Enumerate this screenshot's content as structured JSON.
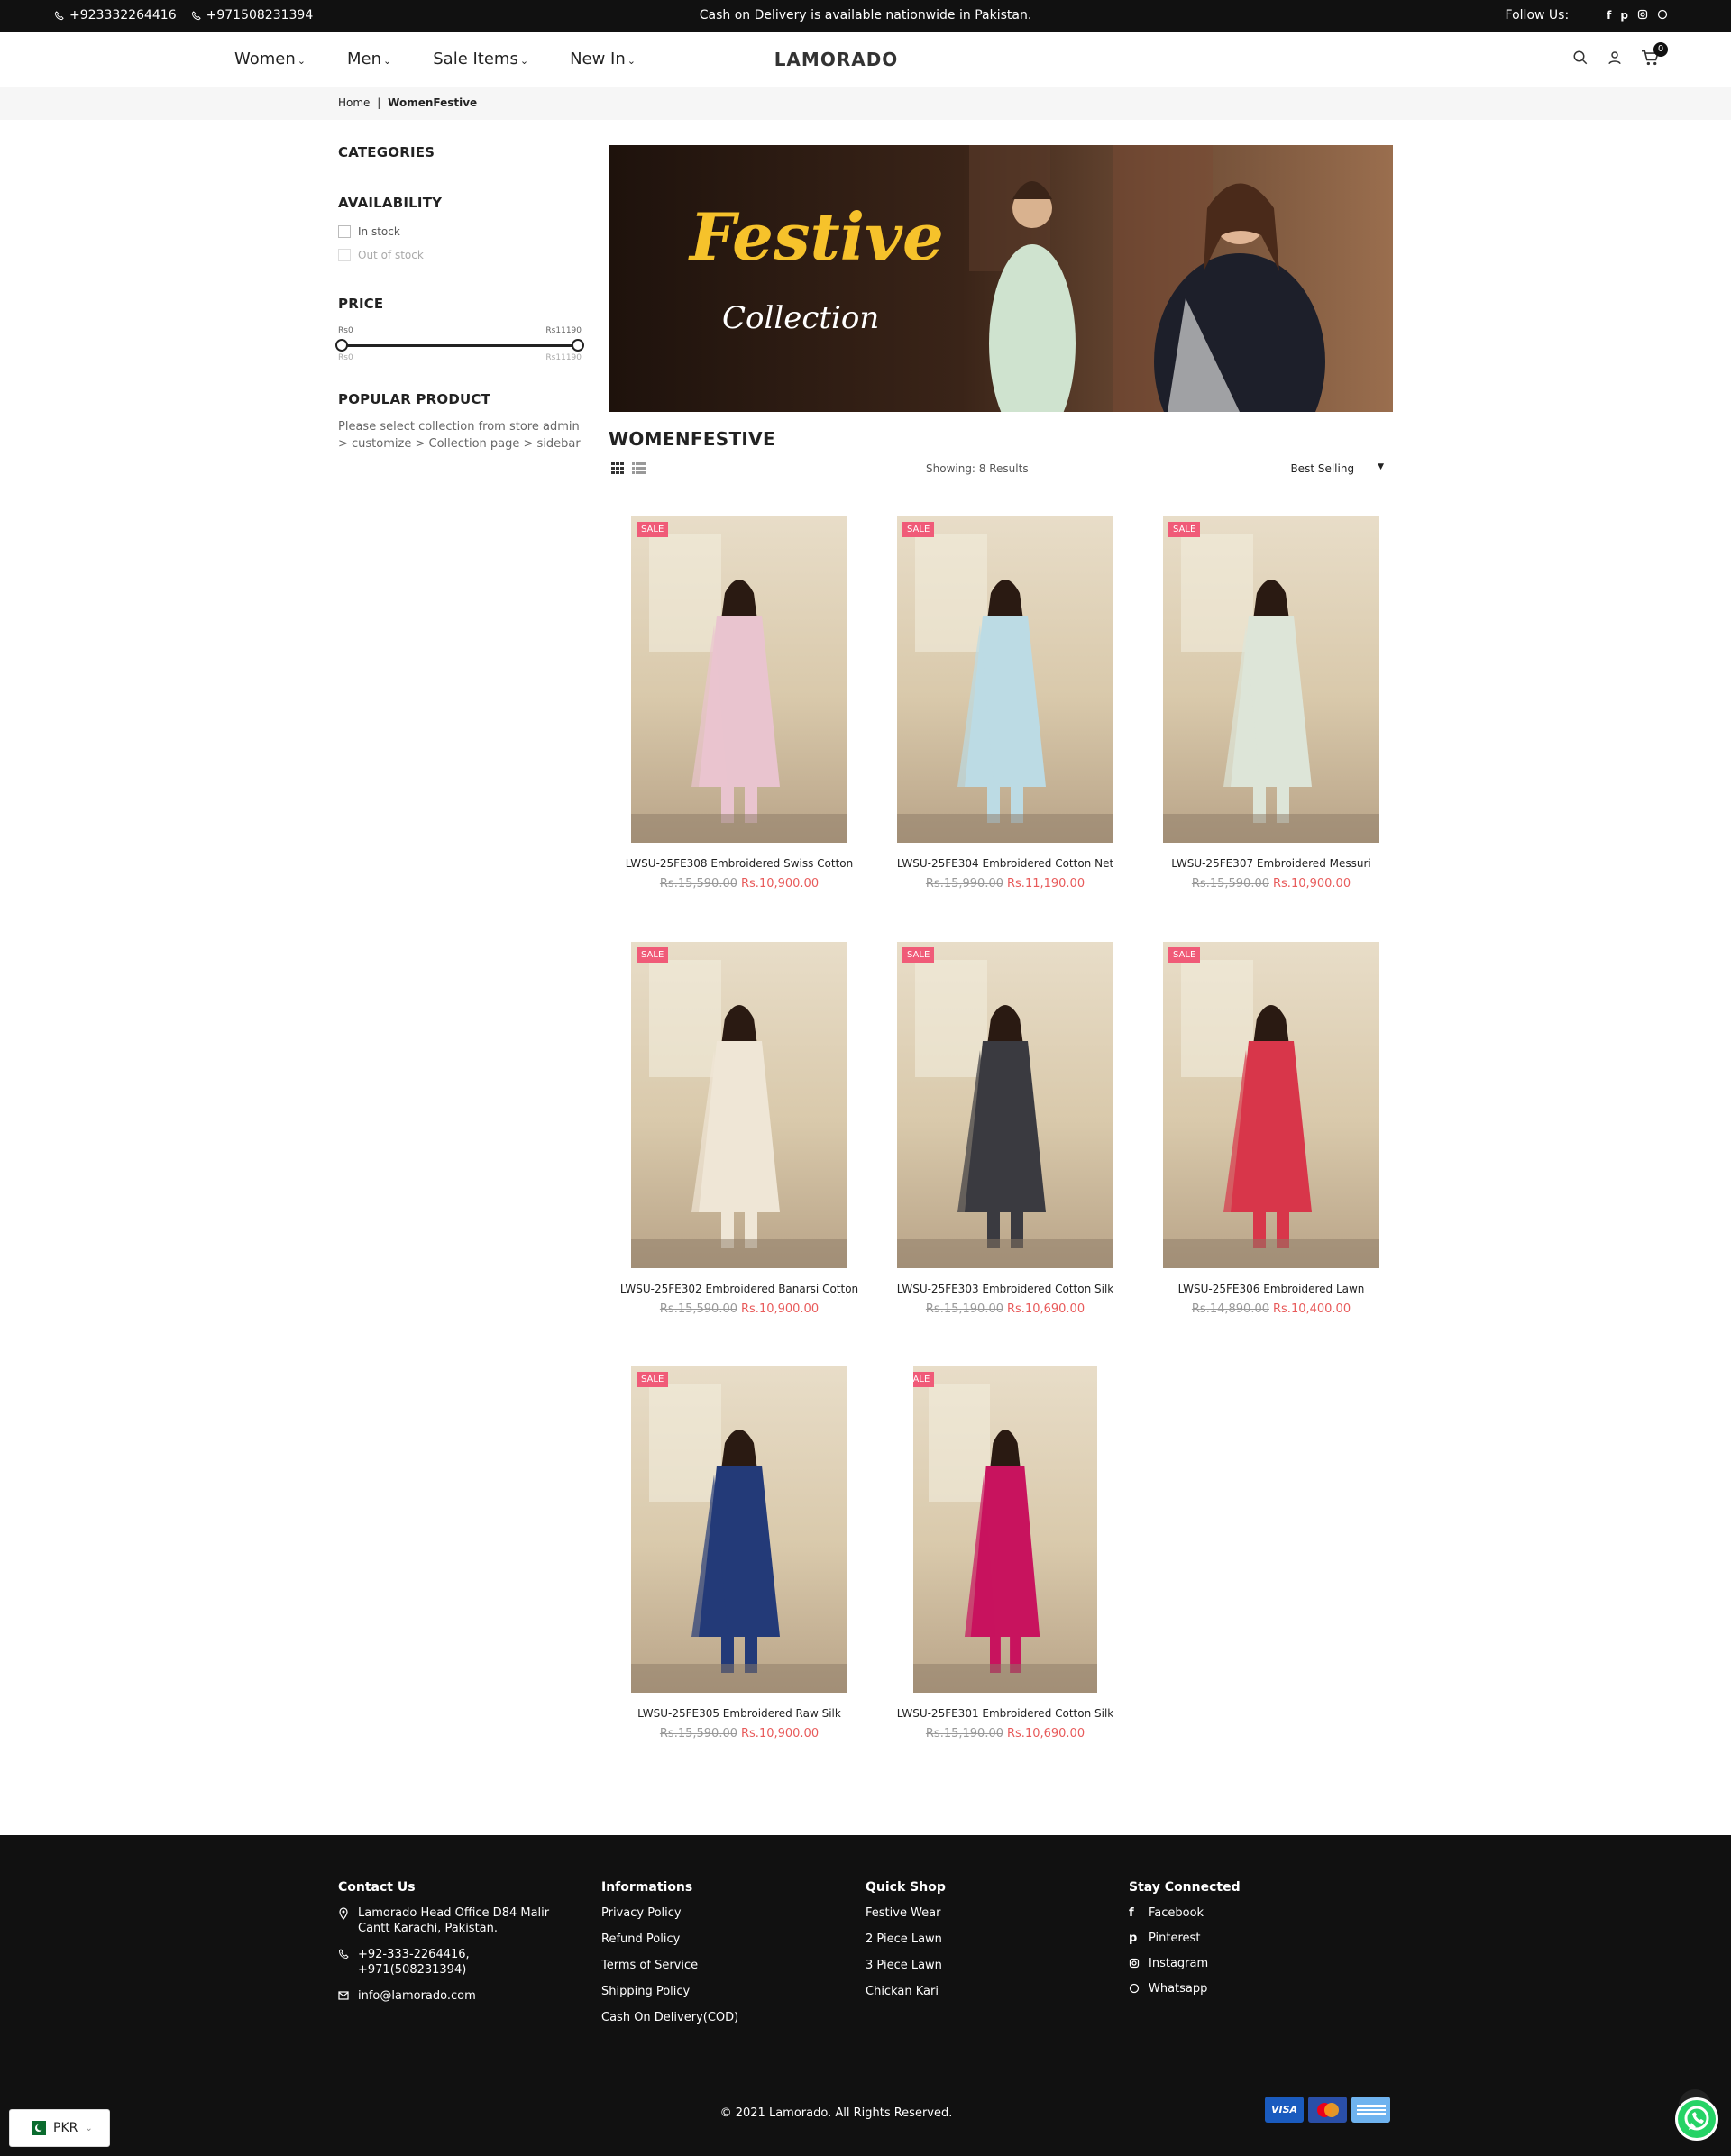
{
  "topbar": {
    "phone1": "+923332264416",
    "phone2": "+971508231394",
    "notice": "Cash on Delivery is available nationwide in Pakistan.",
    "follow_label": "Follow Us:",
    "social": [
      "facebook-icon",
      "pinterest-icon",
      "instagram-icon",
      "whatsapp-icon"
    ]
  },
  "nav": {
    "items": [
      {
        "label": "Women"
      },
      {
        "label": "Men"
      },
      {
        "label": "Sale Items"
      },
      {
        "label": "New In"
      }
    ],
    "logo": "LAMORADO",
    "cart_count": "0"
  },
  "breadcrumb": {
    "home": "Home",
    "separator": "|",
    "current": "WomenFestive"
  },
  "sidebar": {
    "categories_title": "CATEGORIES",
    "availability_title": "AVAILABILITY",
    "in_stock": "In stock",
    "out_of_stock": "Out of stock",
    "price_title": "PRICE",
    "price_min": "Rs0",
    "price_max": "Rs11190",
    "popular_title": "POPULAR PRODUCT",
    "popular_text": "Please select collection from store admin > customize > Collection page > sidebar"
  },
  "banner": {
    "line1": "Festive",
    "line2": "Collection"
  },
  "collection": {
    "title": "WOMENFESTIVE",
    "showing": "Showing: 8 Results",
    "sort": "Best Selling"
  },
  "products": [
    {
      "name": "LWSU-25FE308 Embroidered Swiss Cotton",
      "old": "Rs.15,590.00",
      "new": "Rs.10,900.00",
      "sale": "SALE",
      "color": "#e9c4cf"
    },
    {
      "name": "LWSU-25FE304 Embroidered Cotton Net",
      "old": "Rs.15,990.00",
      "new": "Rs.11,190.00",
      "sale": "SALE",
      "color": "#bcdbe4"
    },
    {
      "name": "LWSU-25FE307 Embroidered Messuri",
      "old": "Rs.15,590.00",
      "new": "Rs.10,900.00",
      "sale": "SALE",
      "color": "#dde5d8"
    },
    {
      "name": "LWSU-25FE302 Embroidered Banarsi Cotton",
      "old": "Rs.15,590.00",
      "new": "Rs.10,900.00",
      "sale": "SALE",
      "color": "#efe6d6"
    },
    {
      "name": "LWSU-25FE303 Embroidered Cotton Silk",
      "old": "Rs.15,190.00",
      "new": "Rs.10,690.00",
      "sale": "SALE",
      "color": "#3a3a40"
    },
    {
      "name": "LWSU-25FE306 Embroidered Lawn",
      "old": "Rs.14,890.00",
      "new": "Rs.10,400.00",
      "sale": "SALE",
      "color": "#d8364a"
    },
    {
      "name": "LWSU-25FE305 Embroidered Raw Silk",
      "old": "Rs.15,590.00",
      "new": "Rs.10,900.00",
      "sale": "SALE",
      "color": "#233a78"
    },
    {
      "name": "LWSU-25FE301 Embroidered Cotton Silk",
      "old": "Rs.15,190.00",
      "new": "Rs.10,690.00",
      "sale": "SALE",
      "color": "#c8135e"
    }
  ],
  "footer": {
    "contact_title": "Contact Us",
    "address": "Lamorado Head Office D84 Malir Cantt Karachi, Pakistan.",
    "phones": "+92-333-2264416, +971(508231394)",
    "email": "info@lamorado.com",
    "info_title": "Informations",
    "info_links": [
      "Privacy Policy",
      "Refund Policy",
      "Terms of Service",
      "Shipping Policy",
      "Cash On Delivery(COD)"
    ],
    "shop_title": "Quick Shop",
    "shop_links": [
      "Festive Wear",
      "2 Piece Lawn",
      "3 Piece Lawn",
      "Chickan Kari"
    ],
    "social_title": "Stay Connected",
    "social_links": [
      "Facebook",
      "Pinterest",
      "Instagram",
      "Whatsapp"
    ],
    "copyright": "© 2021 Lamorado. All Rights Reserved.",
    "payments": [
      "VISA",
      "mastercard-icon",
      "amex-icon"
    ]
  },
  "currency": {
    "code": "PKR"
  }
}
